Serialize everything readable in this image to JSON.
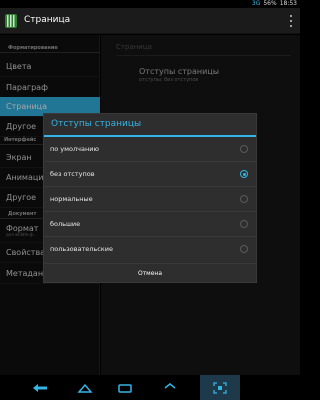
{
  "statusbar": {
    "signal": "3G",
    "battery": "56%",
    "time": "18:53"
  },
  "actionbar": {
    "title": "Страница"
  },
  "sidebar": {
    "headers": [
      "Форматирование",
      "Интерфейс",
      "Документ"
    ],
    "items": [
      {
        "label": "Цвета"
      },
      {
        "label": "Параграф"
      },
      {
        "label": "Страница",
        "active": true
      },
      {
        "label": "Другое"
      },
      {
        "label": "Экран"
      },
      {
        "label": "Анимация"
      },
      {
        "label": "Другое"
      },
      {
        "label": "Формат",
        "sub": "для widdle-ф..."
      },
      {
        "label": "Свойства"
      },
      {
        "label": "Метаданные"
      }
    ]
  },
  "detail": {
    "title": "Страница",
    "pref_title": "Отступы страницы",
    "pref_summary": "отступы: без отступов"
  },
  "dialog": {
    "title": "Отступы страницы",
    "options": [
      {
        "label": "по умолчанию",
        "checked": false
      },
      {
        "label": "без отступов",
        "checked": true
      },
      {
        "label": "нормальные",
        "checked": false
      },
      {
        "label": "большие",
        "checked": false
      },
      {
        "label": "пользовательские",
        "checked": false
      }
    ],
    "cancel": "Отмена"
  },
  "colors": {
    "accent": "#33b5e5"
  },
  "icons": [
    "app-icon",
    "overflow-icon",
    "back-icon",
    "home-icon",
    "recents-icon",
    "screenshot-icon"
  ]
}
